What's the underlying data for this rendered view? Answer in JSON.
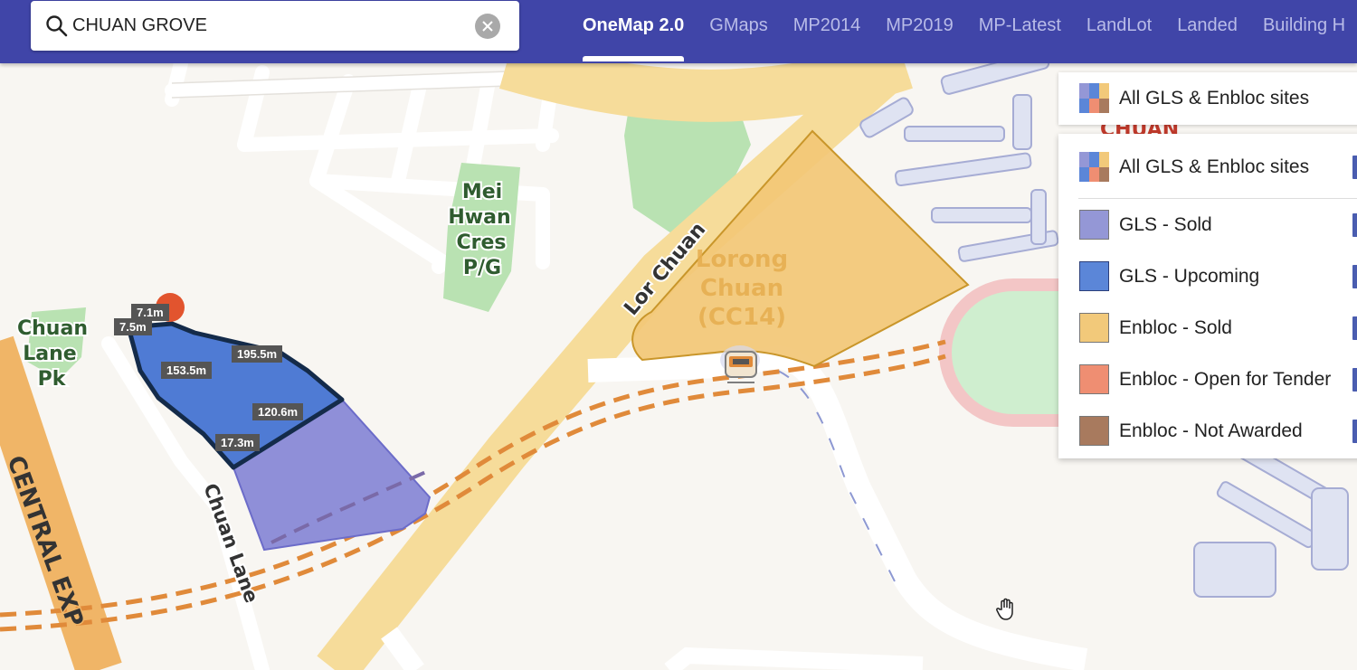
{
  "search": {
    "value": "CHUAN GROVE"
  },
  "nav": {
    "tabs": [
      {
        "label": "OneMap 2.0",
        "active": true
      },
      {
        "label": "GMaps"
      },
      {
        "label": "MP2014"
      },
      {
        "label": "MP2019"
      },
      {
        "label": "MP-Latest"
      },
      {
        "label": "LandLot"
      },
      {
        "label": "Landed"
      },
      {
        "label": "Building H"
      }
    ]
  },
  "layers": {
    "toggle_label": "All GLS & Enbloc sites",
    "legend": [
      {
        "label": "All GLS & Enbloc sites",
        "color": "multi"
      },
      {
        "label": "GLS - Sold",
        "color": "#9497d6"
      },
      {
        "label": "GLS - Upcoming",
        "color": "#5b86d8"
      },
      {
        "label": "Enbloc - Sold",
        "color": "#f2c97a"
      },
      {
        "label": "Enbloc - Open for Tender",
        "color": "#ef8e72"
      },
      {
        "label": "Enbloc - Not Awarded",
        "color": "#a87a5e"
      }
    ]
  },
  "map": {
    "road_labels": {
      "lor_chuan": "Lor Chuan",
      "chuan_lane": "Chuan Lane",
      "central_exp": "CENTRAL EXP"
    },
    "park_labels": {
      "mei_hwan_line1": "Mei",
      "mei_hwan_line2": "Hwan",
      "mei_hwan_line3": "Cres",
      "mei_hwan_line4": "P/G",
      "chuan_lane_pk_line1": "Chuan",
      "chuan_lane_pk_line2": "Lane",
      "chuan_lane_pk_line3": "Pk"
    },
    "station_label": {
      "line1": "Lorong",
      "line2": "Chuan",
      "line3": "(CC14)"
    },
    "area_label": "CHUAN",
    "measurements": {
      "m1": "7.1m",
      "m2": "7.5m",
      "m3": "195.5m",
      "m4": "153.5m",
      "m5": "120.6m",
      "m6": "17.3m"
    }
  }
}
